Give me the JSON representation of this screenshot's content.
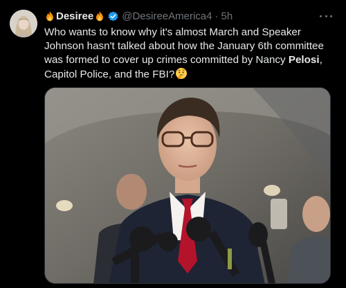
{
  "author": {
    "display_name": "Desiree",
    "handle": "@DesireeAmerica4",
    "separator": "·",
    "time": "5h"
  },
  "tweet": {
    "text_1": "Who wants to know why it's almost March and Speaker Johnson hasn't talked about how the January 6th committee was formed to cover up crimes committed by Nancy ",
    "text_bold": "Pelosi",
    "text_2": ", Capitol Police, and the FBI?"
  },
  "icons": {
    "fire": "fire-emoji-icon",
    "verified": "verified-badge-icon",
    "thinking": "thinking-face-emoji-icon",
    "more": "more-options-icon"
  },
  "colors": {
    "background": "#000000",
    "primary_text": "#e7e9ea",
    "secondary_text": "#71767b",
    "verified_blue": "#1d9bf0"
  }
}
